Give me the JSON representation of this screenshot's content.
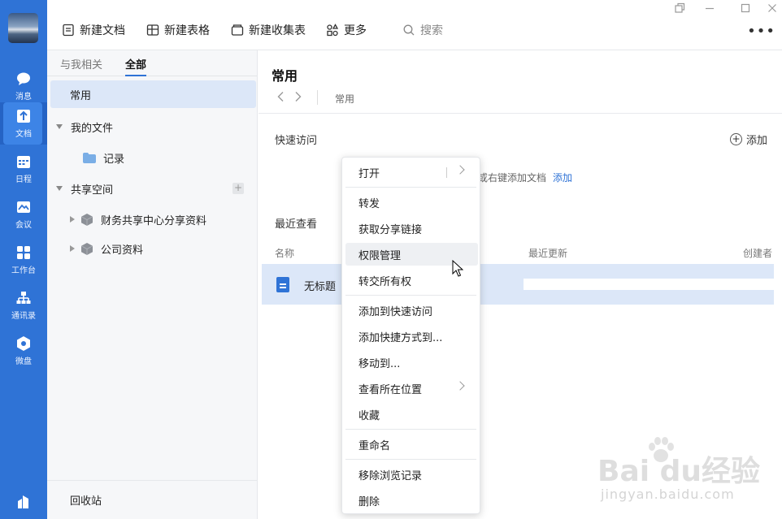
{
  "rail": {
    "items": [
      {
        "label": "消息",
        "icon": "message-icon"
      },
      {
        "label": "文档",
        "icon": "document-icon",
        "active": true
      },
      {
        "label": "日程",
        "icon": "calendar-icon"
      },
      {
        "label": "会议",
        "icon": "meeting-icon"
      },
      {
        "label": "工作台",
        "icon": "workbench-icon"
      },
      {
        "label": "通讯录",
        "icon": "contacts-icon"
      },
      {
        "label": "微盘",
        "icon": "drive-icon"
      }
    ]
  },
  "toolbar": {
    "new_doc": "新建文档",
    "new_sheet": "新建表格",
    "new_form": "新建收集表",
    "more": "更多",
    "search_placeholder": "搜索"
  },
  "nav": {
    "tabs": [
      "与我相关",
      "全部"
    ],
    "active_tab": "全部",
    "common": "常用",
    "my_files": "我的文件",
    "records": "记录",
    "shared_space": "共享空间",
    "shared_items": [
      "财务共享中心分享资料",
      "公司资料"
    ],
    "recycle_bin": "回收站"
  },
  "main": {
    "title": "常用",
    "breadcrumb": "常用",
    "quick_access": "快速访问",
    "add": "添加",
    "hint": "或右键添加文档",
    "hint_link": "添加",
    "recent": "最近查看",
    "columns": {
      "name": "名称",
      "updated": "最近更新",
      "creator": "创建者"
    },
    "file_name": "无标题"
  },
  "context_menu": {
    "items": [
      "打开",
      "转发",
      "获取分享链接",
      "权限管理",
      "转交所有权",
      "添加到快速访问",
      "添加快捷方式到...",
      "移动到...",
      "查看所在位置",
      "收藏",
      "重命名",
      "移除浏览记录",
      "删除"
    ],
    "hovered": "权限管理"
  },
  "watermark": {
    "brand": "Bai du经验",
    "url": "jingyan.baidu.com"
  },
  "colors": {
    "accent": "#2f73d6",
    "selected": "#dce7f8"
  }
}
